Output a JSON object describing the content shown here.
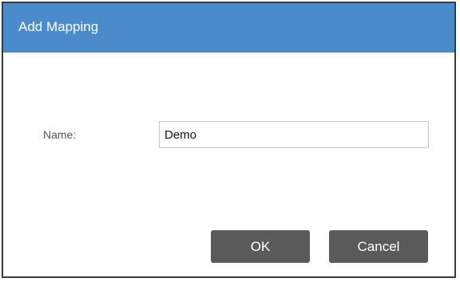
{
  "dialog": {
    "title": "Add Mapping",
    "title_bar_color": "#4b8bcb",
    "name_label": "Name:",
    "name_value": "Demo",
    "ok_label": "OK",
    "cancel_label": "Cancel",
    "button_color": "#5a5a5a"
  }
}
